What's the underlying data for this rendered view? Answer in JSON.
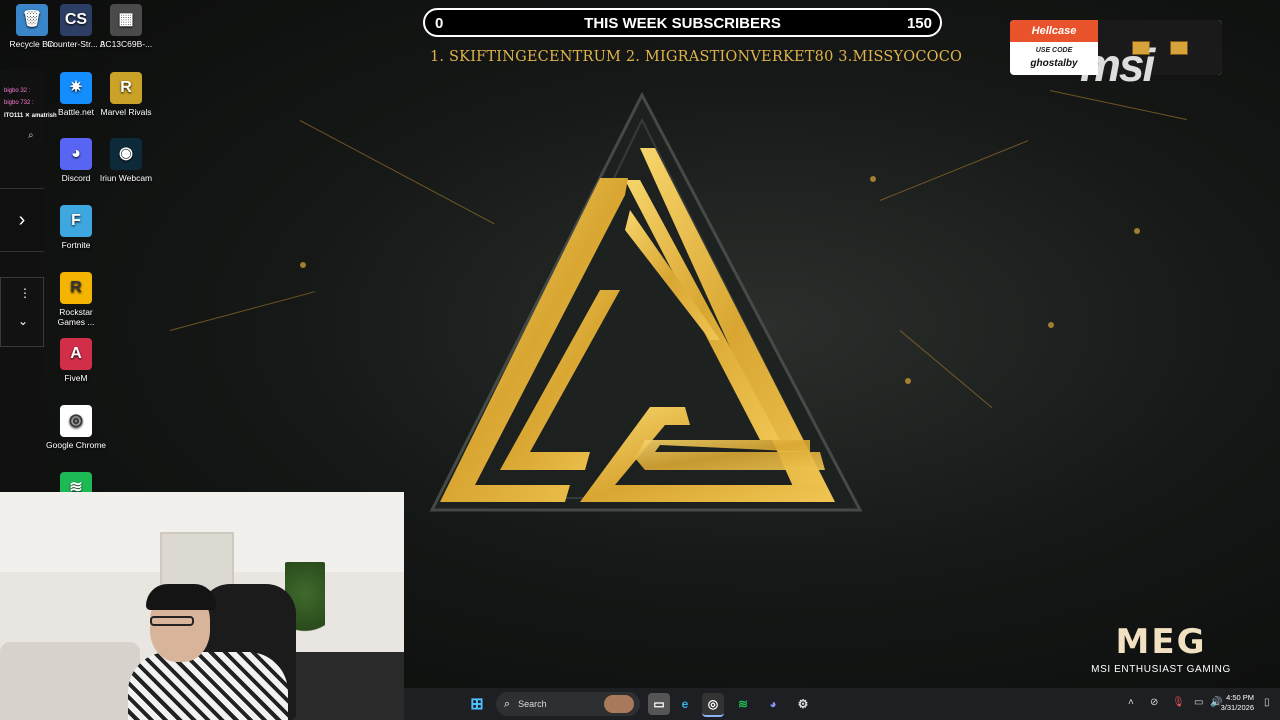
{
  "desktop_icons": [
    {
      "label": "Recycle Bin",
      "color": "#3a86c8",
      "glyph": "🗑"
    },
    {
      "label": "Counter-Str... 2",
      "color": "#2c3e63",
      "glyph": "CS"
    },
    {
      "label": "AC13C69B-...",
      "color": "#4a4a4a",
      "glyph": "▦"
    },
    {
      "label": "Battle.net",
      "color": "#148eff",
      "glyph": "✷"
    },
    {
      "label": "Marvel Rivals",
      "color": "#c9a227",
      "glyph": "R"
    },
    {
      "label": "Discord",
      "color": "#5865f2",
      "glyph": "◕"
    },
    {
      "label": "Iriun Webcam",
      "color": "#0d2a3a",
      "glyph": "◉"
    },
    {
      "label": "Fortnite",
      "color": "#3fa7e0",
      "glyph": "F"
    },
    {
      "label": "Rockstar Games ...",
      "color": "#f5b400",
      "glyph": "R"
    },
    {
      "label": "FiveM",
      "color": "#d22e4a",
      "glyph": "A"
    },
    {
      "label": "Google Chrome",
      "color": "#ffffff",
      "glyph": "◎"
    },
    {
      "label": "",
      "color": "#1db954",
      "glyph": "≋"
    }
  ],
  "chat": {
    "lines": [
      "bigbo 32 :",
      "bigbo 732 :",
      "ITO111 ✕ amatrish"
    ]
  },
  "subscriber_bar": {
    "left_value": "0",
    "title": "THIS WEEK SUBSCRIBERS",
    "right_value": "150"
  },
  "top_subscribers": "1. SKIFTINGECENTRUM  2. MIGRASTIONVERKET80  3.MISSYOCOCO",
  "hellcase": {
    "brand": "Hellcase",
    "use_code_label": "USE CODE",
    "code": "ghostalby"
  },
  "msi_ghost_text": "msi",
  "meg": {
    "mark": "MEG",
    "subtitle": "MSI ENTHUSIAST GAMING"
  },
  "taskbar": {
    "search_placeholder": "Search",
    "time": "4:50 PM",
    "date": "3/31/2026"
  },
  "colors": {
    "gold": "#e0b34a",
    "marble": "#151816"
  }
}
